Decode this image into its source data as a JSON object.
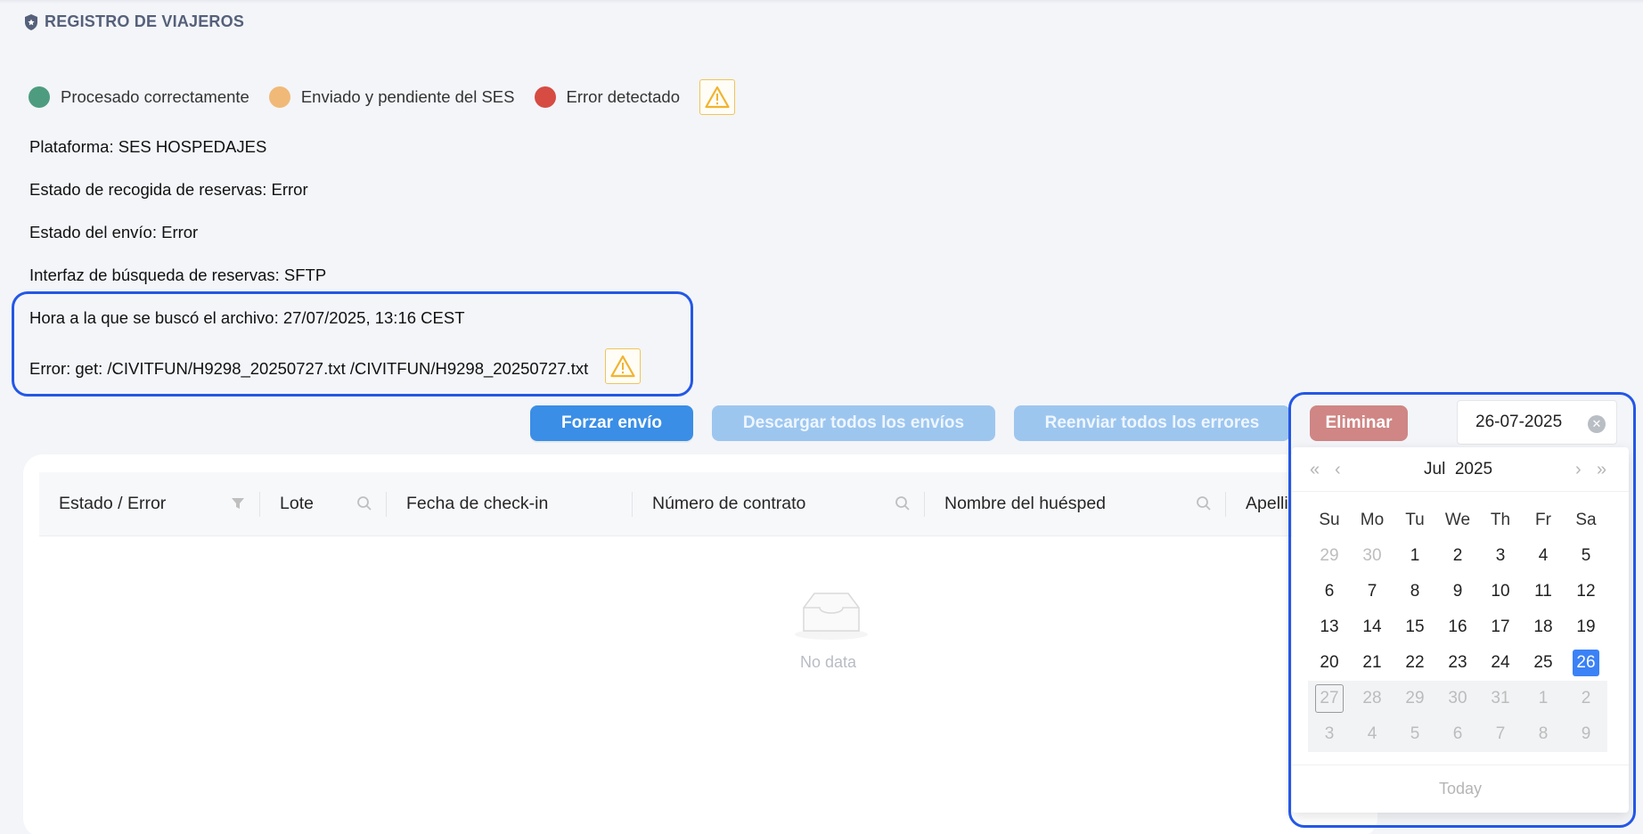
{
  "header": {
    "title": "REGISTRO DE VIAJEROS",
    "icon": "shield-icon"
  },
  "legend": {
    "items": [
      {
        "label": "Procesado correctamente",
        "color": "#4e9c7f"
      },
      {
        "label": "Enviado y pendiente del SES",
        "color": "#f0b978"
      },
      {
        "label": "Error detectado",
        "color": "#d64c43"
      }
    ],
    "warning_icon": "warning-icon"
  },
  "info": {
    "platform": "Plataforma: SES HOSPEDAJES",
    "collection_status": "Estado de recogida de reservas: Error",
    "send_status": "Estado del envío: Error",
    "search_interface": "Interfaz de búsqueda de reservas: SFTP",
    "file_search_time": "Hora a la que se buscó el archivo: 27/07/2025, 13:16 CEST",
    "error_message": "Error: get: /CIVITFUN/H9298_20250727.txt /CIVITFUN/H9298_20250727.txt"
  },
  "actions": {
    "force_send": "Forzar envío",
    "download_all": "Descargar todos los envíos",
    "resend_errors": "Reenviar todos los errores",
    "delete": "Eliminar"
  },
  "date_filter": {
    "value": "26-07-2025"
  },
  "table": {
    "columns": [
      "Estado / Error",
      "Lote",
      "Fecha de check-in",
      "Número de contrato",
      "Nombre del huésped",
      "Apelli"
    ],
    "empty_text": "No data"
  },
  "calendar": {
    "month": "Jul",
    "year": "2025",
    "weekdays": [
      "Su",
      "Mo",
      "Tu",
      "We",
      "Th",
      "Fr",
      "Sa"
    ],
    "weeks": [
      [
        "29",
        "30",
        "1",
        "2",
        "3",
        "4",
        "5"
      ],
      [
        "6",
        "7",
        "8",
        "9",
        "10",
        "11",
        "12"
      ],
      [
        "13",
        "14",
        "15",
        "16",
        "17",
        "18",
        "19"
      ],
      [
        "20",
        "21",
        "22",
        "23",
        "24",
        "25",
        "26"
      ],
      [
        "27",
        "28",
        "29",
        "30",
        "31",
        "1",
        "2"
      ],
      [
        "3",
        "4",
        "5",
        "6",
        "7",
        "8",
        "9"
      ]
    ],
    "selected": "26",
    "today_label": "Today",
    "accent": "#3b82f6"
  },
  "annotation_color": "#2457e6"
}
